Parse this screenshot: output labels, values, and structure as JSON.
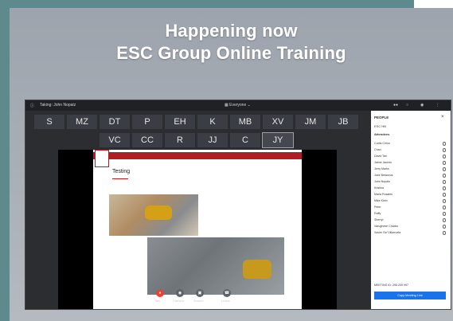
{
  "banner": {
    "line1": "Happening now",
    "line2": "ESC Group Online Training"
  },
  "topbar": {
    "taking": "Taking: John Nopatz",
    "audience": "Everyone"
  },
  "initials_row1": [
    "S",
    "MZ",
    "DT",
    "P",
    "EH",
    "K",
    "MB",
    "XV",
    "JM",
    "JB"
  ],
  "initials_row2": [
    "VC",
    "CC",
    "R",
    "JJ",
    "C",
    "JY"
  ],
  "slide": {
    "title": "Testing"
  },
  "controls": [
    "Talk",
    "Camera",
    "Screen",
    "Leave"
  ],
  "people_panel": {
    "header": "PEOPLE",
    "host_label": "ESC HB",
    "attendees_label": "Attendees",
    "attendees": [
      "Curtis Cirino",
      "Chan",
      "David Tan",
      "Jaime Jacinto",
      "Jerry Marks",
      "Jose Betanzos",
      "John Nopatz",
      "Kristina",
      "Maria Rosales",
      "Mike Klein",
      "Peter",
      "Raffy",
      "Sherryl",
      "Varughese Chacko",
      "Xavier Sei Villarruela"
    ],
    "meeting_id": "MEETING ID: 295 209 997",
    "copy_link": "Copy Meeting Link"
  }
}
